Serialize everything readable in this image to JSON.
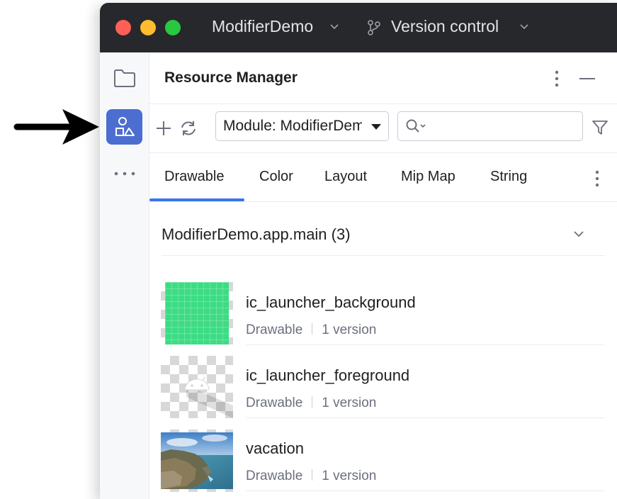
{
  "window": {
    "project_name": "ModifierDemo",
    "vcs_label": "Version control"
  },
  "sidebar": {
    "items": [
      {
        "icon": "folder-icon"
      },
      {
        "icon": "resource-manager-icon",
        "selected": true
      },
      {
        "icon": "more-horizontal-icon"
      }
    ],
    "accent": "#4c6ed1"
  },
  "panel": {
    "title": "Resource Manager",
    "module_value": "Module: ModifierDemo.app",
    "search_value": "",
    "tabs": [
      {
        "label": "Drawable",
        "selected": true
      },
      {
        "label": "Color"
      },
      {
        "label": "Layout"
      },
      {
        "label": "Mip Map"
      },
      {
        "label": "String"
      }
    ]
  },
  "resources": {
    "group_title": "ModifierDemo.app.main (3)",
    "items": [
      {
        "name": "ic_launcher_background",
        "type": "Drawable",
        "versions": "1 version"
      },
      {
        "name": "ic_launcher_foreground",
        "type": "Drawable",
        "versions": "1 version"
      },
      {
        "name": "vacation",
        "type": "Drawable",
        "versions": "1 version"
      }
    ]
  }
}
